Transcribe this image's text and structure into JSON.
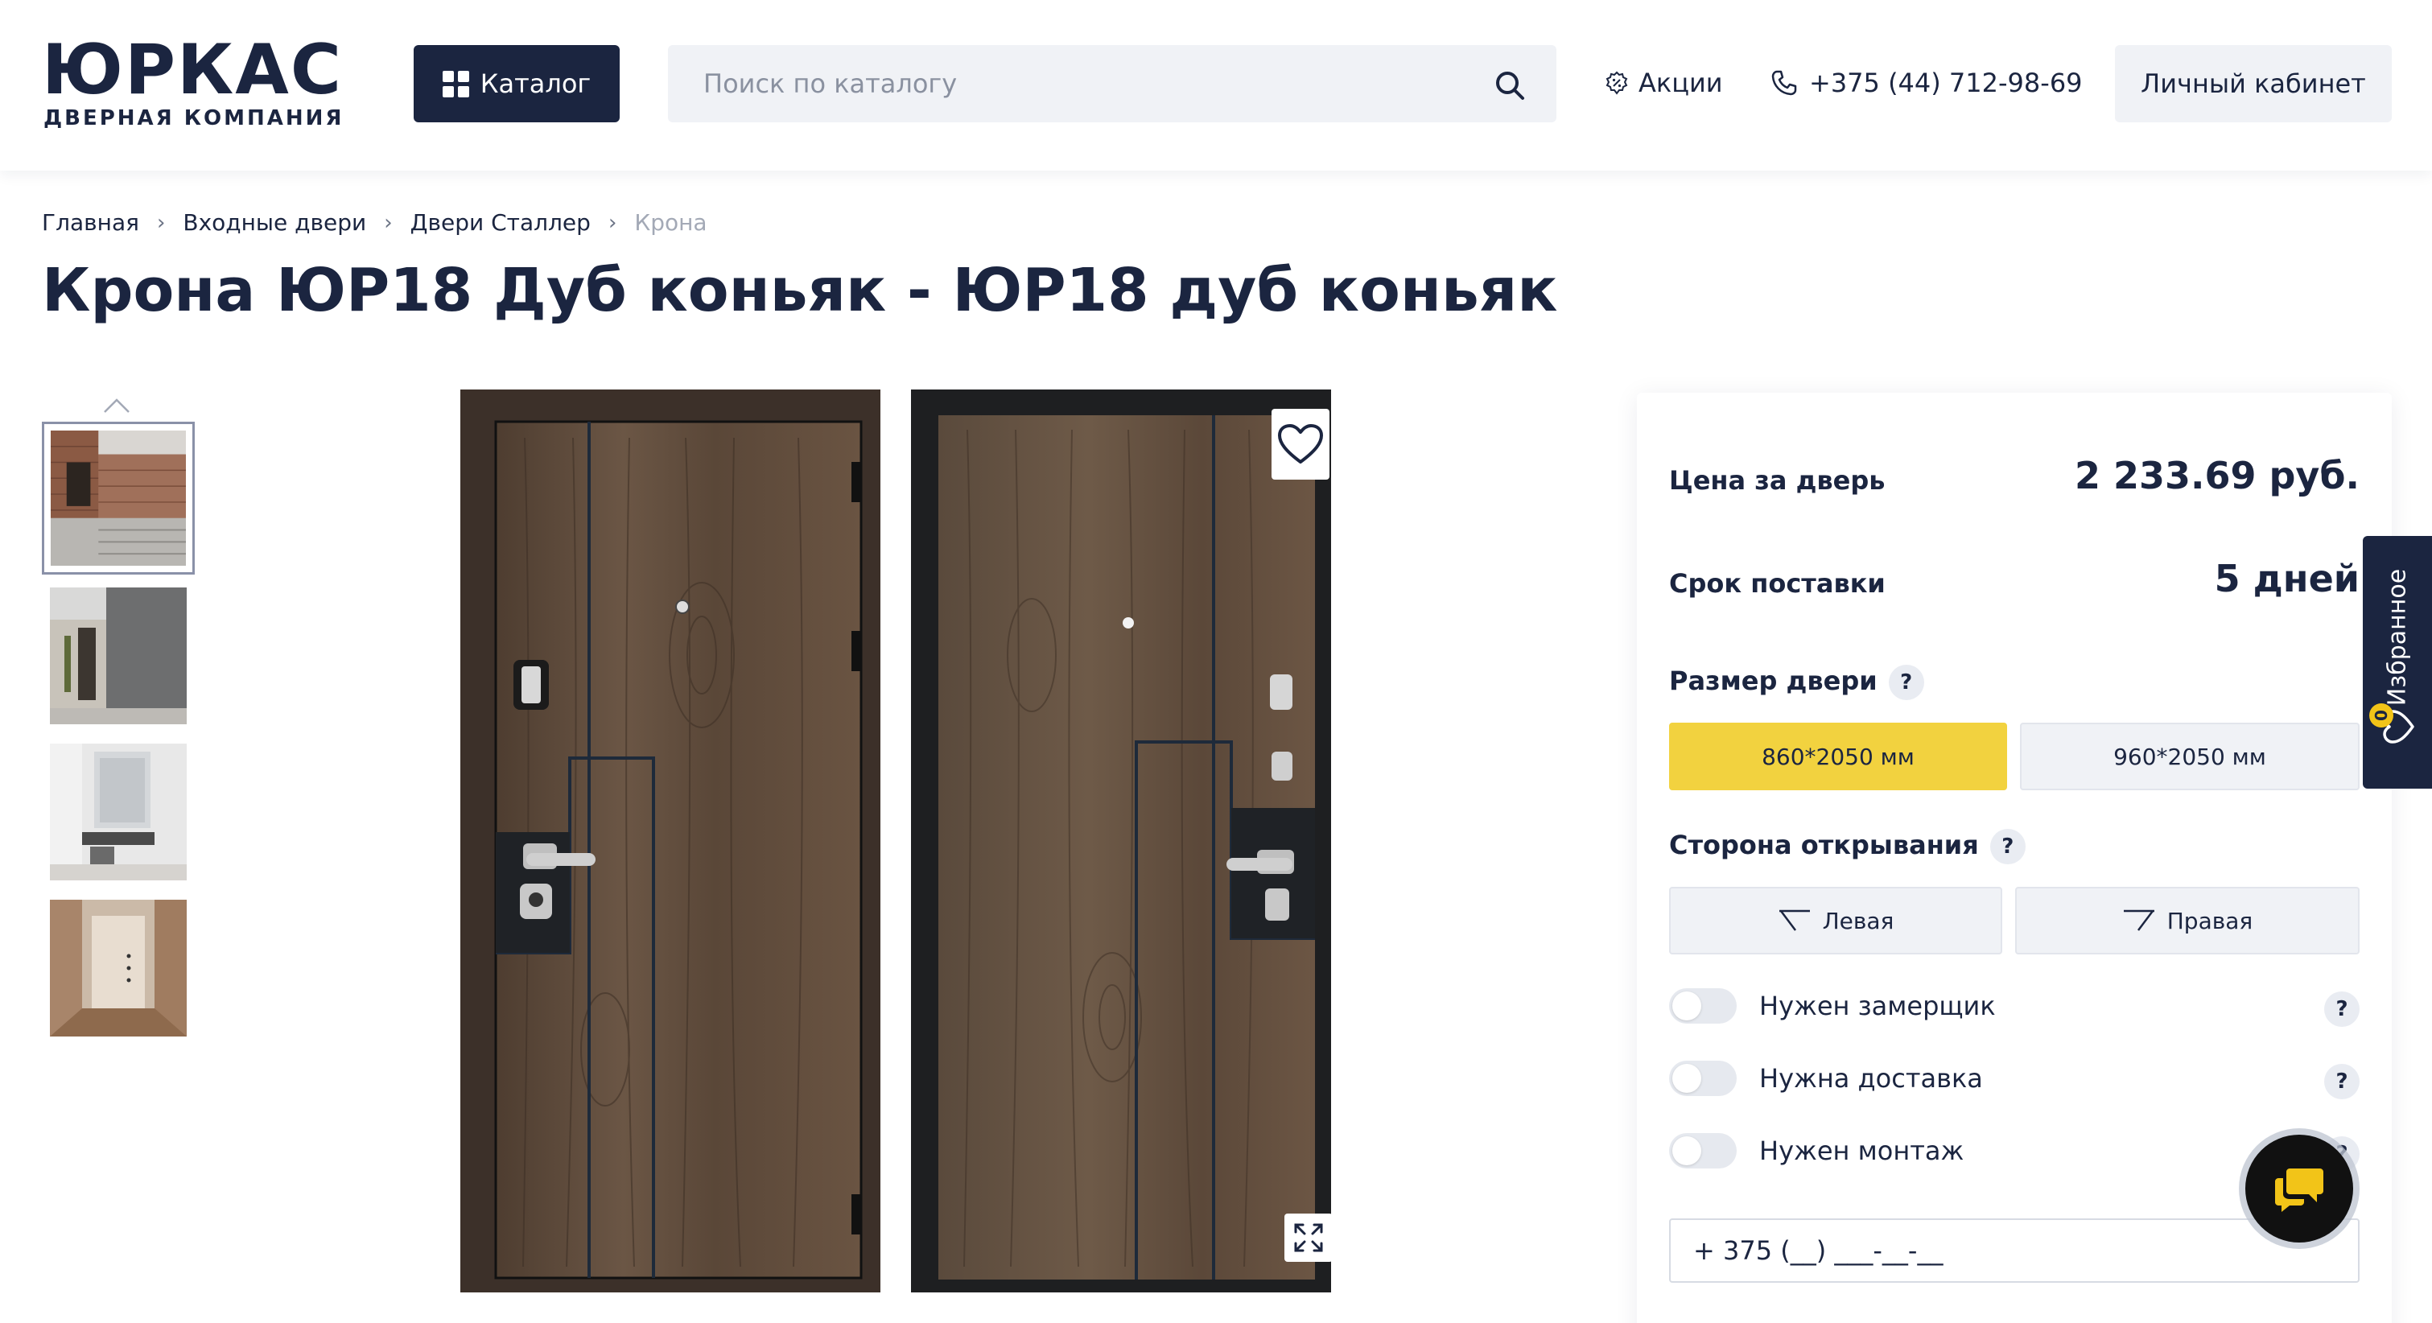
{
  "header": {
    "logo_text": "ЮРКАС",
    "logo_subtitle": "ДВЕРНАЯ КОМПАНИЯ",
    "catalog_label": "Каталог",
    "search_placeholder": "Поиск по каталогу",
    "promo_label": "Акции",
    "phone": "+375 (44) 712-98-69",
    "cabinet_label": "Личный кабинет"
  },
  "breadcrumb": [
    {
      "label": "Главная"
    },
    {
      "label": "Входные двери"
    },
    {
      "label": "Двери Сталлер"
    },
    {
      "label": "Крона"
    }
  ],
  "breadcrumb_separator": "›",
  "title": "Крона ЮР18 Дуб коньяк - ЮР18 дуб коньяк",
  "gallery": {
    "thumbnails": [
      {
        "name": "facade-interior-thumb"
      },
      {
        "name": "concrete-hall-thumb"
      },
      {
        "name": "white-hall-thumb"
      },
      {
        "name": "beige-corridor-thumb"
      }
    ],
    "active_index": 0
  },
  "panel": {
    "price_label": "Цена за дверь",
    "price_value": "2 233.69 руб.",
    "delivery_label": "Срок поставки",
    "delivery_value": "5 дней",
    "size_label": "Размер двери",
    "size_options": [
      "860*2050 мм",
      "960*2050 мм"
    ],
    "size_selected": "860*2050 мм",
    "side_label": "Сторона открывания",
    "side_options": [
      "Левая",
      "Правая"
    ],
    "help_symbol": "?",
    "toggles": [
      {
        "label": "Нужен замерщик",
        "on": false
      },
      {
        "label": "Нужна доставка",
        "on": false
      },
      {
        "label": "Нужен монтаж",
        "on": false
      }
    ],
    "phone_value": "+ 375 (__) ___-__-__"
  },
  "favorites_tab": {
    "label": "Избранное",
    "count": "0"
  },
  "colors": {
    "navy": "#1b2540",
    "accent_yellow": "#f2d23f",
    "light_bg": "#f0f2f6",
    "door_wood": "#5e4c3c"
  }
}
